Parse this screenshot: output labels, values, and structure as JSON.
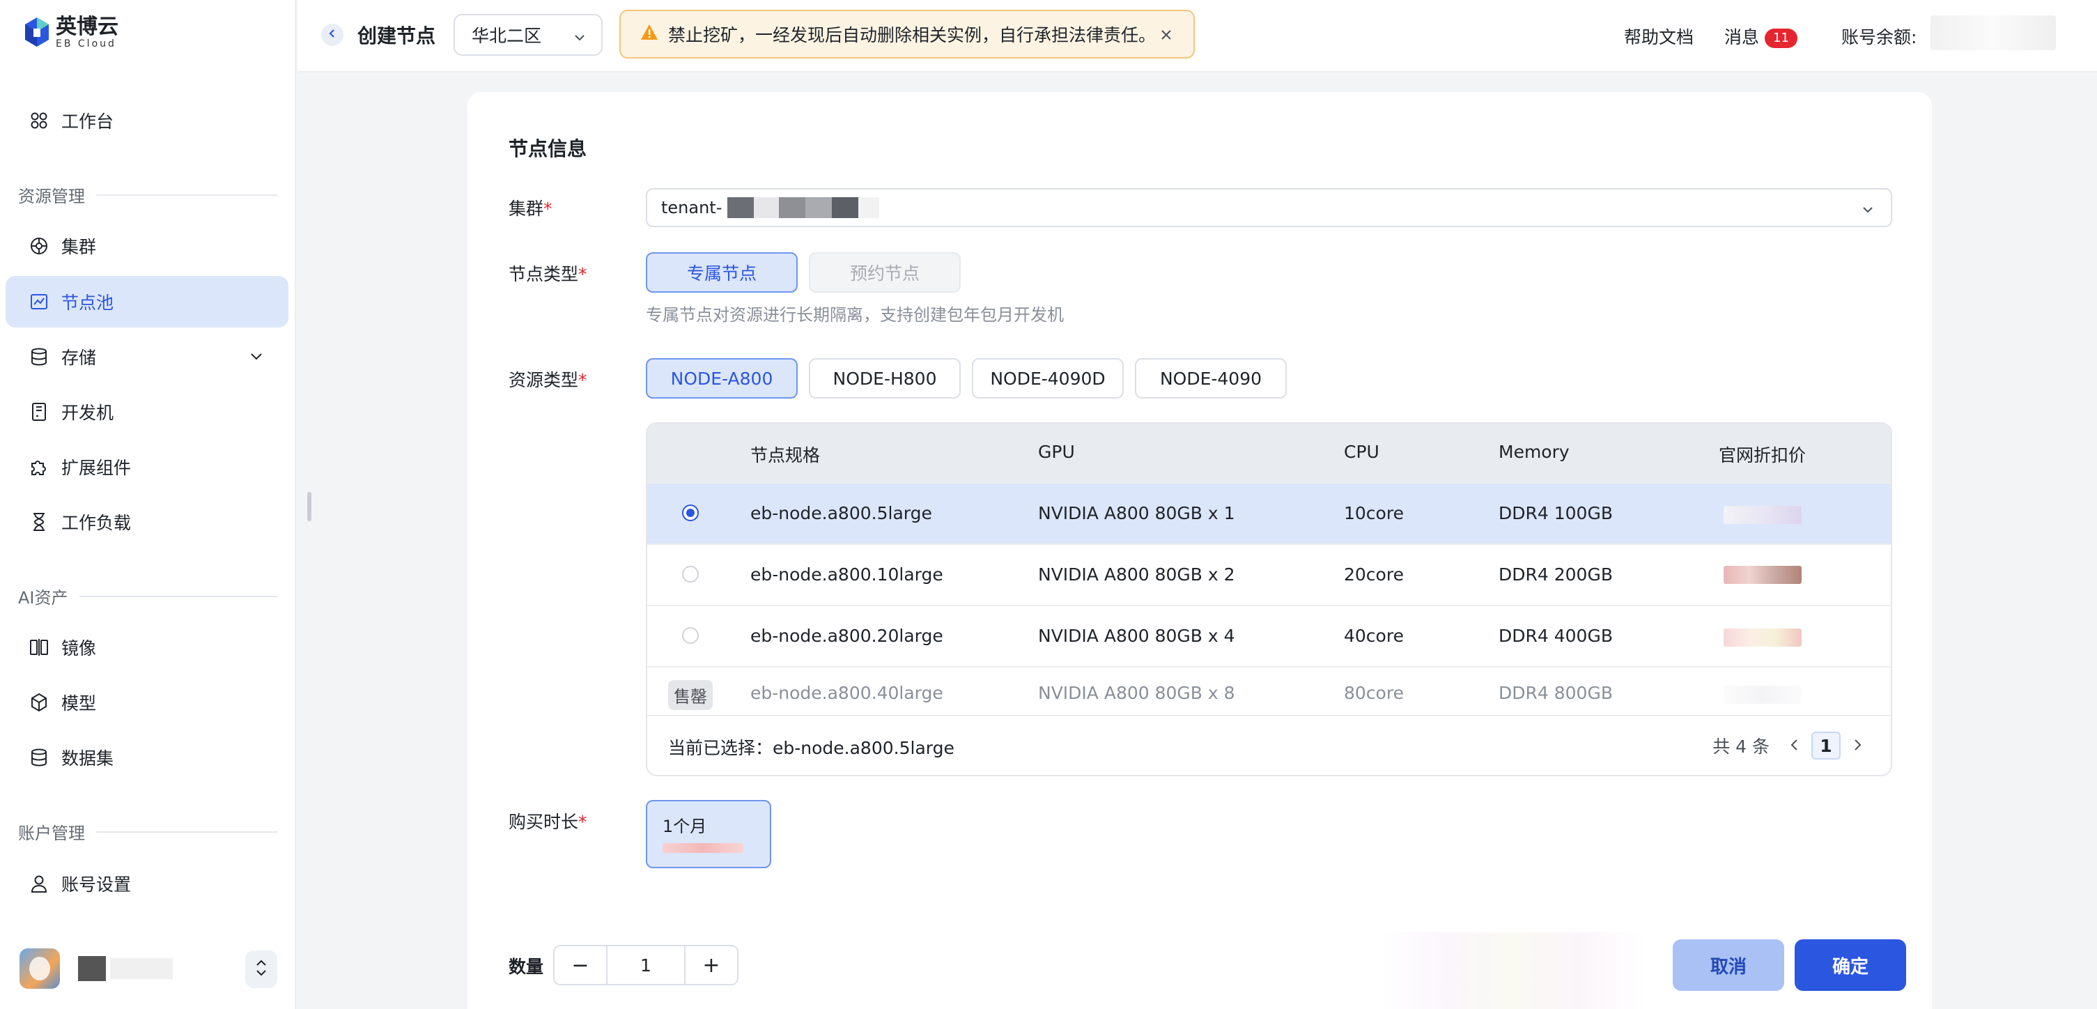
{
  "brand": {
    "name_cn": "英博云",
    "name_en": "EB Cloud"
  },
  "sidebar": {
    "workbench": "工作台",
    "group_resource": "资源管理",
    "cluster": "集群",
    "node_pool": "节点池",
    "storage": "存储",
    "devbox": "开发机",
    "extensions": "扩展组件",
    "workloads": "工作负载",
    "group_ai": "AI资产",
    "images": "镜像",
    "models": "模型",
    "datasets": "数据集",
    "group_account": "账户管理",
    "account_settings": "账号设置"
  },
  "topbar": {
    "title": "创建节点",
    "region": "华北二区",
    "warning": "禁止挖矿，一经发现后自动删除相关实例，自行承担法律责任。",
    "help": "帮助文档",
    "messages": "消息",
    "message_count": "11",
    "balance_label": "账号余额:"
  },
  "form": {
    "section_title": "节点信息",
    "cluster_label": "集群",
    "cluster_value": "tenant-",
    "node_type_label": "节点类型",
    "node_type_options": [
      "专属节点",
      "预约节点"
    ],
    "node_type_hint": "专属节点对资源进行长期隔离，支持创建包年包月开发机",
    "resource_type_label": "资源类型",
    "resource_type_options": [
      "NODE-A800",
      "NODE-H800",
      "NODE-4090D",
      "NODE-4090"
    ],
    "required_mark": "*",
    "table": {
      "headers": [
        "节点规格",
        "GPU",
        "CPU",
        "Memory",
        "官网折扣价"
      ],
      "rows": [
        {
          "spec": "eb-node.a800.5large",
          "gpu": "NVIDIA A800 80GB x 1",
          "cpu": "10core",
          "memory": "DDR4 100GB"
        },
        {
          "spec": "eb-node.a800.10large",
          "gpu": "NVIDIA A800 80GB x 2",
          "cpu": "20core",
          "memory": "DDR4 200GB"
        },
        {
          "spec": "eb-node.a800.20large",
          "gpu": "NVIDIA A800 80GB x 4",
          "cpu": "40core",
          "memory": "DDR4 400GB"
        },
        {
          "spec": "eb-node.a800.40large",
          "gpu": "NVIDIA A800 80GB x 8",
          "cpu": "80core",
          "memory": "DDR4 800GB",
          "tag": "售罄"
        }
      ],
      "current_selected_label": "当前已选择：eb-node.a800.5large",
      "total": "共 4 条",
      "page": "1"
    },
    "duration_label": "购买时长",
    "duration_option": "1个月",
    "quantity_label": "数量",
    "quantity_value": "1",
    "minus": "−",
    "plus": "+"
  },
  "actions": {
    "cancel": "取消",
    "confirm": "确定"
  },
  "colors": {
    "accent": "#2b56e0",
    "selected_bg": "#dce6fb",
    "warning_bg": "#fdf3e3",
    "danger": "#e5252f"
  }
}
